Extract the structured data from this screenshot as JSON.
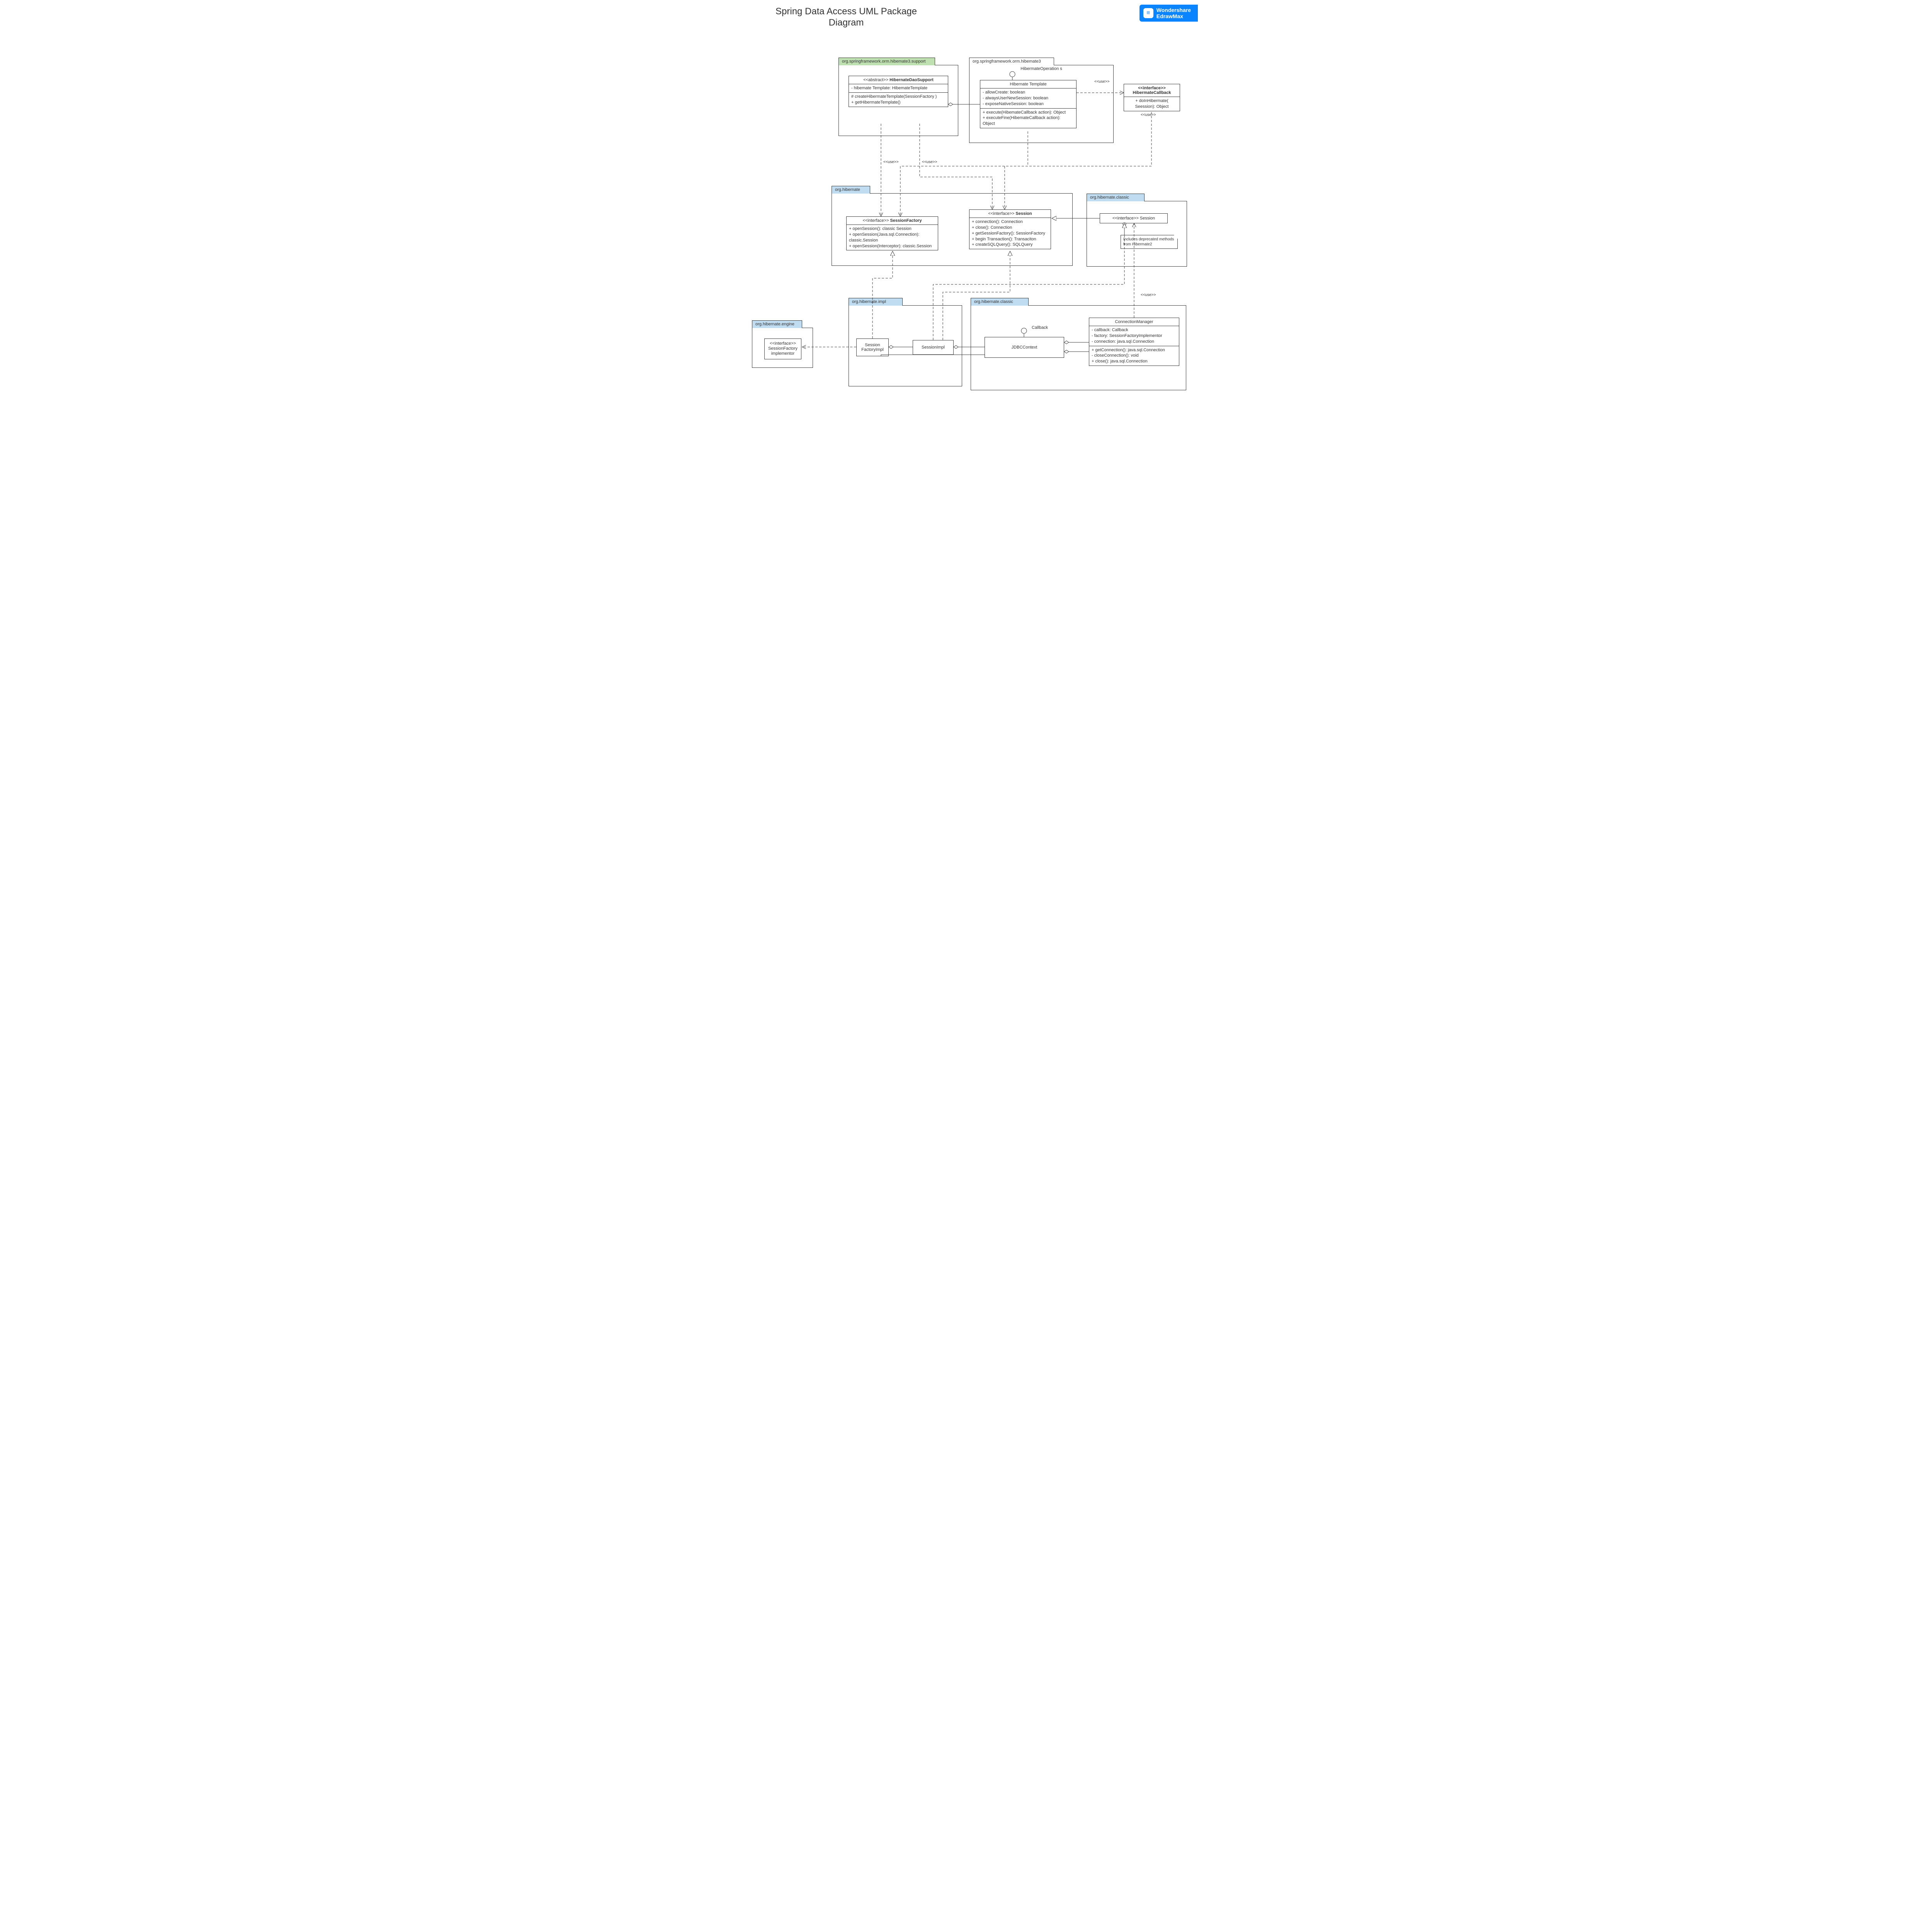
{
  "title": "Spring Data Access UML Package Diagram",
  "watermark": {
    "brand": "Wondershare",
    "product": "EdrawMax",
    "icon": "≡"
  },
  "labels": {
    "use": "<<use>>",
    "callback": "Callback",
    "hibernateOps": "HibermateOperation s"
  },
  "packages": {
    "p_support": {
      "name": "org.springframework.orm.hibemate3.support"
    },
    "p_hib3": {
      "name": "org.springframework.orm.hibemate3"
    },
    "p_hibernate": {
      "name": "org.hibernate"
    },
    "p_classic": {
      "name": "org.hibernate.classic"
    },
    "p_impl": {
      "name": "org.hibernate.impl"
    },
    "p_classic2": {
      "name": "org.hibernate.classic"
    },
    "p_engine": {
      "name": "org.hibernate.engine"
    }
  },
  "classes": {
    "daoSupport": {
      "stereo": "<<abstract>> ",
      "name": "HibernateDaoSupport",
      "attrs": "- hibemate Template: HibemateTemplate",
      "ops": "# createHibermateTemplate(SessionFactory )\n+ getHibermateTemplate()"
    },
    "template": {
      "name": "Hibernate Template",
      "attrs": "- allowCreate: boolean\n- alwaysUserNewSession: boolean\n- exposeNativeSession: boolean",
      "ops": "+ execute(HibemateCallback action): Object\n+ executeFine(HibemateCallback action): Object"
    },
    "callback": {
      "stereo": "<<interface>>",
      "name": "HibermateCallback",
      "ops": "+ doInHibermate( Seession): Object"
    },
    "sessFactory": {
      "stereo": "<<interface>> ",
      "name": "SessionFactory",
      "ops": "+ openSession(): classic Session\n+ openSession(Java.sql.Connection): classic.Session\n+ openSession(Interceptor): classic.Session"
    },
    "session": {
      "stereo": "<<interface>> ",
      "name": "Session",
      "ops": "+ connection(): Connection\n+ close(): Connection\n+ getSessionFactory(): SessionFactory\n+ begin Transaction(): Transaciton\n+ createSQLQuery(): SQLQuery"
    },
    "classicSession": {
      "stereo": "<<interface>> ",
      "name": "Session"
    },
    "classicNote": "Includes deprecated methods from Hibermate2",
    "sessFactoryImpl": "Session FactoryImpl",
    "sessImpl": "SessionImpl",
    "jdbcContext": "JDBCContext",
    "connMgr": {
      "name": "ConnectionManager",
      "attrs": "- callback: Callback\n- factory: SessionFactoryImplementor\n- connection: java.sql.Connection",
      "ops": "+ getConnection(): java.sql.Connection\n- closeConnection(): void\n+ close(): java.sql.Connection"
    },
    "sfImplementor": {
      "stereo": "<<interface>>",
      "name": "SessionFactory implementor"
    }
  }
}
